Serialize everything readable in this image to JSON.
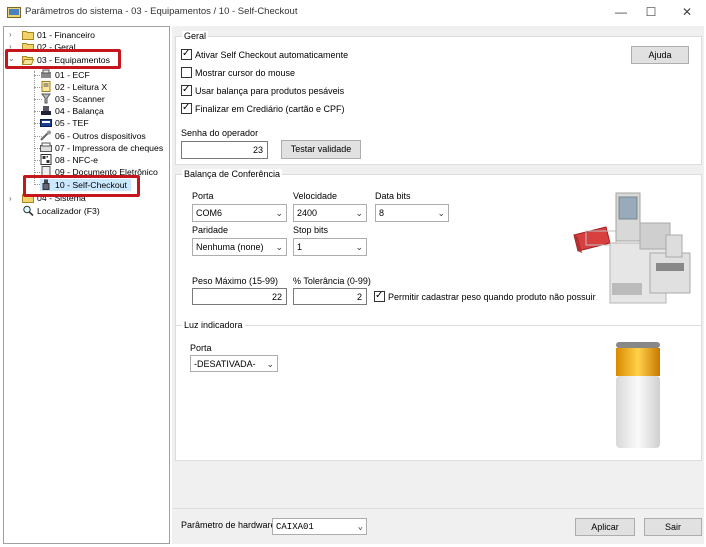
{
  "window": {
    "title": "Parâmetros do sistema - 03 - Equipamentos / 10 - Self-Checkout",
    "minimize": "—",
    "maximize": "☐",
    "close": "✕"
  },
  "tree": {
    "financeiro": "01 - Financeiro",
    "geral": "02 - Geral",
    "equipamentos": "03 - Equipamentos",
    "children": [
      "01 - ECF",
      "02 - Leitura X",
      "03 - Scanner",
      "04 - Balança",
      "05 - TEF",
      "06 - Outros dispositivos",
      "07 - Impressora de cheques",
      "08 - NFC-e",
      "09 - Documento Eletrônico",
      "10 - Self-Checkout"
    ],
    "sistema": "04 - Sistema",
    "localizador": "Localizador (F3)"
  },
  "geral": {
    "title": "Geral",
    "ativar_label": "Ativar Self Checkout automaticamente",
    "ativar_checked": true,
    "mostrar_label": "Mostrar cursor do mouse",
    "mostrar_checked": false,
    "usar_label": "Usar balança para produtos pesáveis",
    "usar_checked": true,
    "finalizar_label": "Finalizar em Crediário (cartão e CPF)",
    "finalizar_checked": true,
    "ajuda_label": "Ajuda",
    "senha_label": "Senha do operador",
    "senha_value": "23",
    "testar_label": "Testar validade"
  },
  "balanca": {
    "title": "Balança de Conferência",
    "porta_label": "Porta",
    "porta_value": "COM6",
    "velocidade_label": "Velocidade",
    "velocidade_value": "2400",
    "databits_label": "Data bits",
    "databits_value": "8",
    "paridade_label": "Paridade",
    "paridade_value": "Nenhuma (none)",
    "stopbits_label": "Stop bits",
    "stopbits_value": "1",
    "peso_label": "Peso Máximo (15-99)",
    "peso_value": "22",
    "tolerancia_label": "% Tolerância (0-99)",
    "tolerancia_value": "2",
    "permitir_label": "Permitir cadastrar peso quando produto não possuir",
    "permitir_checked": true
  },
  "luz": {
    "title": "Luz indicadora",
    "porta_label": "Porta",
    "porta_value": "-DESATIVADA-"
  },
  "footer": {
    "hardware_label": "Parâmetro de hardware",
    "hardware_value": "CAIXA01",
    "aplicar_label": "Aplicar",
    "sair_label": "Sair"
  },
  "colors": {
    "highlight_red": "#c4161c",
    "selection": "#cce8ff"
  }
}
